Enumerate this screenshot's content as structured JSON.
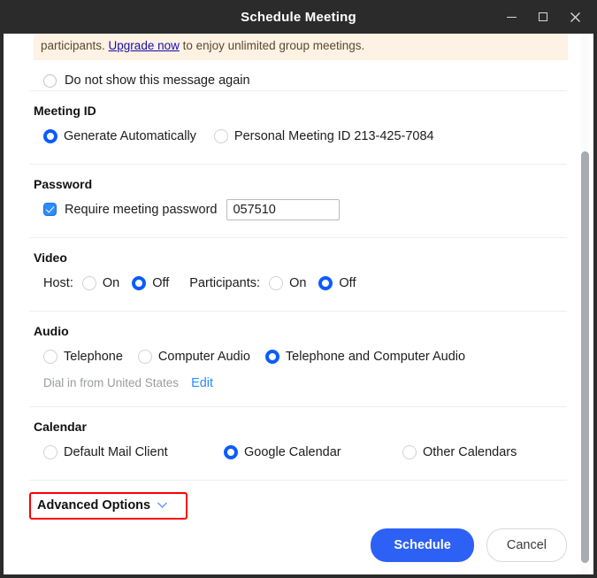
{
  "window": {
    "title": "Schedule Meeting",
    "controls": {
      "minimize": "minimize-icon",
      "maximize": "maximize-icon",
      "close": "close-icon"
    }
  },
  "banner": {
    "text_before": "participants. ",
    "link": "Upgrade now",
    "text_after": " to enjoy unlimited group meetings.",
    "background_color": "#fdf2e3",
    "link_color": "#1a0dab"
  },
  "dismiss": {
    "label": "Do not show this message again",
    "checked": false
  },
  "sections": {
    "meeting_id": {
      "title": "Meeting ID",
      "options": [
        {
          "label": "Generate Automatically",
          "selected": true
        },
        {
          "label": "Personal Meeting ID 213-425-7084",
          "selected": false
        }
      ]
    },
    "password": {
      "title": "Password",
      "checkbox_label": "Require meeting password",
      "checkbox_checked": true,
      "value": "057510",
      "placeholder": ""
    },
    "video": {
      "title": "Video",
      "host_label": "Host:",
      "host_options": [
        {
          "label": "On",
          "selected": false
        },
        {
          "label": "Off",
          "selected": true
        }
      ],
      "participants_label": "Participants:",
      "participants_options": [
        {
          "label": "On",
          "selected": false
        },
        {
          "label": "Off",
          "selected": true
        }
      ]
    },
    "audio": {
      "title": "Audio",
      "options": [
        {
          "label": "Telephone",
          "selected": false
        },
        {
          "label": "Computer Audio",
          "selected": false
        },
        {
          "label": "Telephone and Computer Audio",
          "selected": true
        }
      ],
      "dial_in_text": "Dial in from United States",
      "edit_link": "Edit"
    },
    "calendar": {
      "title": "Calendar",
      "options": [
        {
          "label": "Default Mail Client",
          "selected": false
        },
        {
          "label": "Google Calendar",
          "selected": true
        },
        {
          "label": "Other Calendars",
          "selected": false
        }
      ]
    }
  },
  "advanced_options": {
    "label": "Advanced Options",
    "chevron": "chevron-down-icon",
    "highlight_color": "#ff0000",
    "expanded": false
  },
  "footer": {
    "primary_label": "Schedule",
    "secondary_label": "Cancel",
    "primary_color": "#2d61f5"
  },
  "scrollbar": {
    "thumb_color": "#a8abaf"
  },
  "theme": {
    "accent": "#0b5cff",
    "checkbox_blue": "#2d8cff",
    "divider": "#eceef0"
  }
}
